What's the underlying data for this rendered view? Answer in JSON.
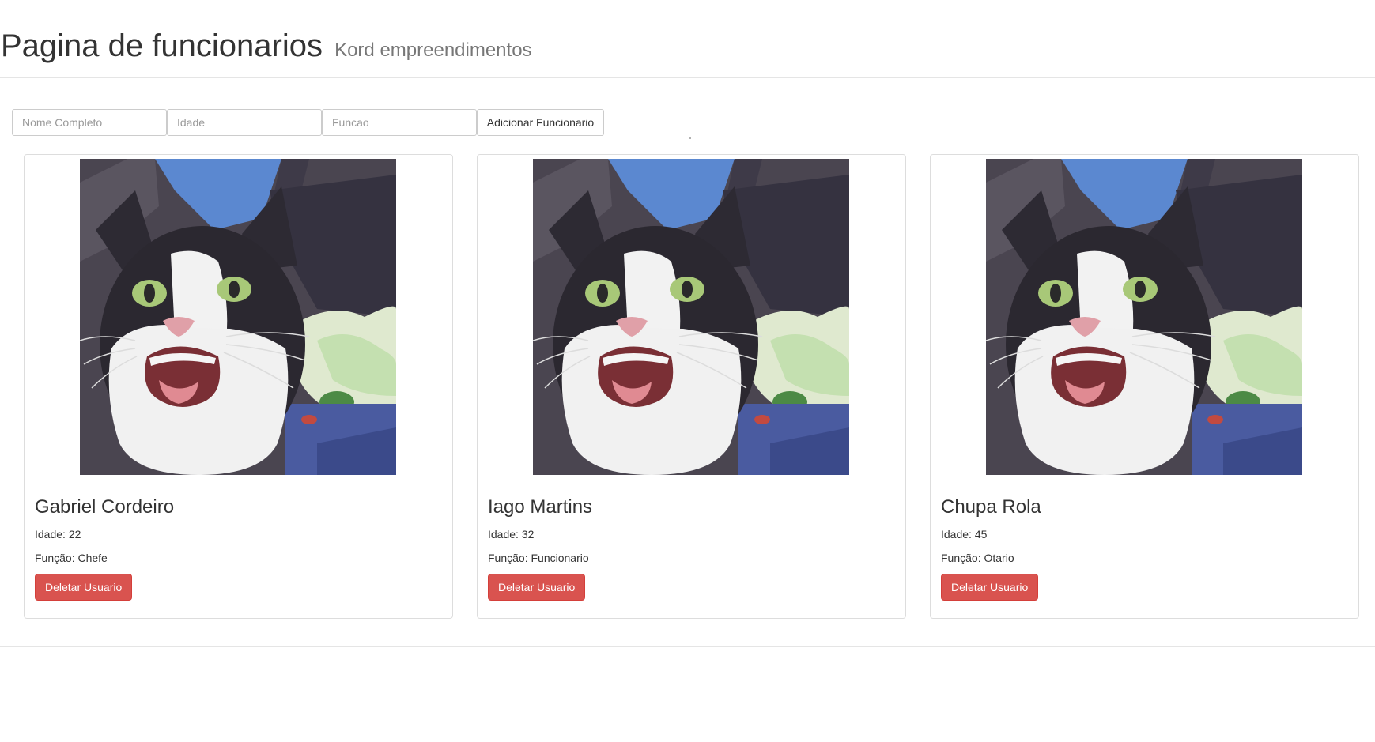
{
  "header": {
    "title": "Pagina de funcionarios",
    "subtitle": "Kord empreendimentos"
  },
  "form": {
    "name_placeholder": "Nome Completo",
    "age_placeholder": "Idade",
    "role_placeholder": "Funcao",
    "add_label": "Adicionar Funcionario"
  },
  "employees": [
    {
      "name": "Gabriel Cordeiro",
      "age": "Idade: 22",
      "role": "Função: Chefe",
      "delete_label": "Deletar Usuario",
      "photo": "surprised-cat-photo"
    },
    {
      "name": "Iago Martins",
      "age": "Idade: 32",
      "role": "Função: Funcionario",
      "delete_label": "Deletar Usuario",
      "photo": "surprised-cat-photo"
    },
    {
      "name": "Chupa Rola",
      "age": "Idade: 45",
      "role": "Função: Otario",
      "delete_label": "Deletar Usuario",
      "photo": "surprised-cat-photo"
    }
  ],
  "colors": {
    "danger": "#d9534f",
    "danger_border": "#d43f3a",
    "text": "#333333",
    "muted": "#777777",
    "border": "#dddddd"
  }
}
